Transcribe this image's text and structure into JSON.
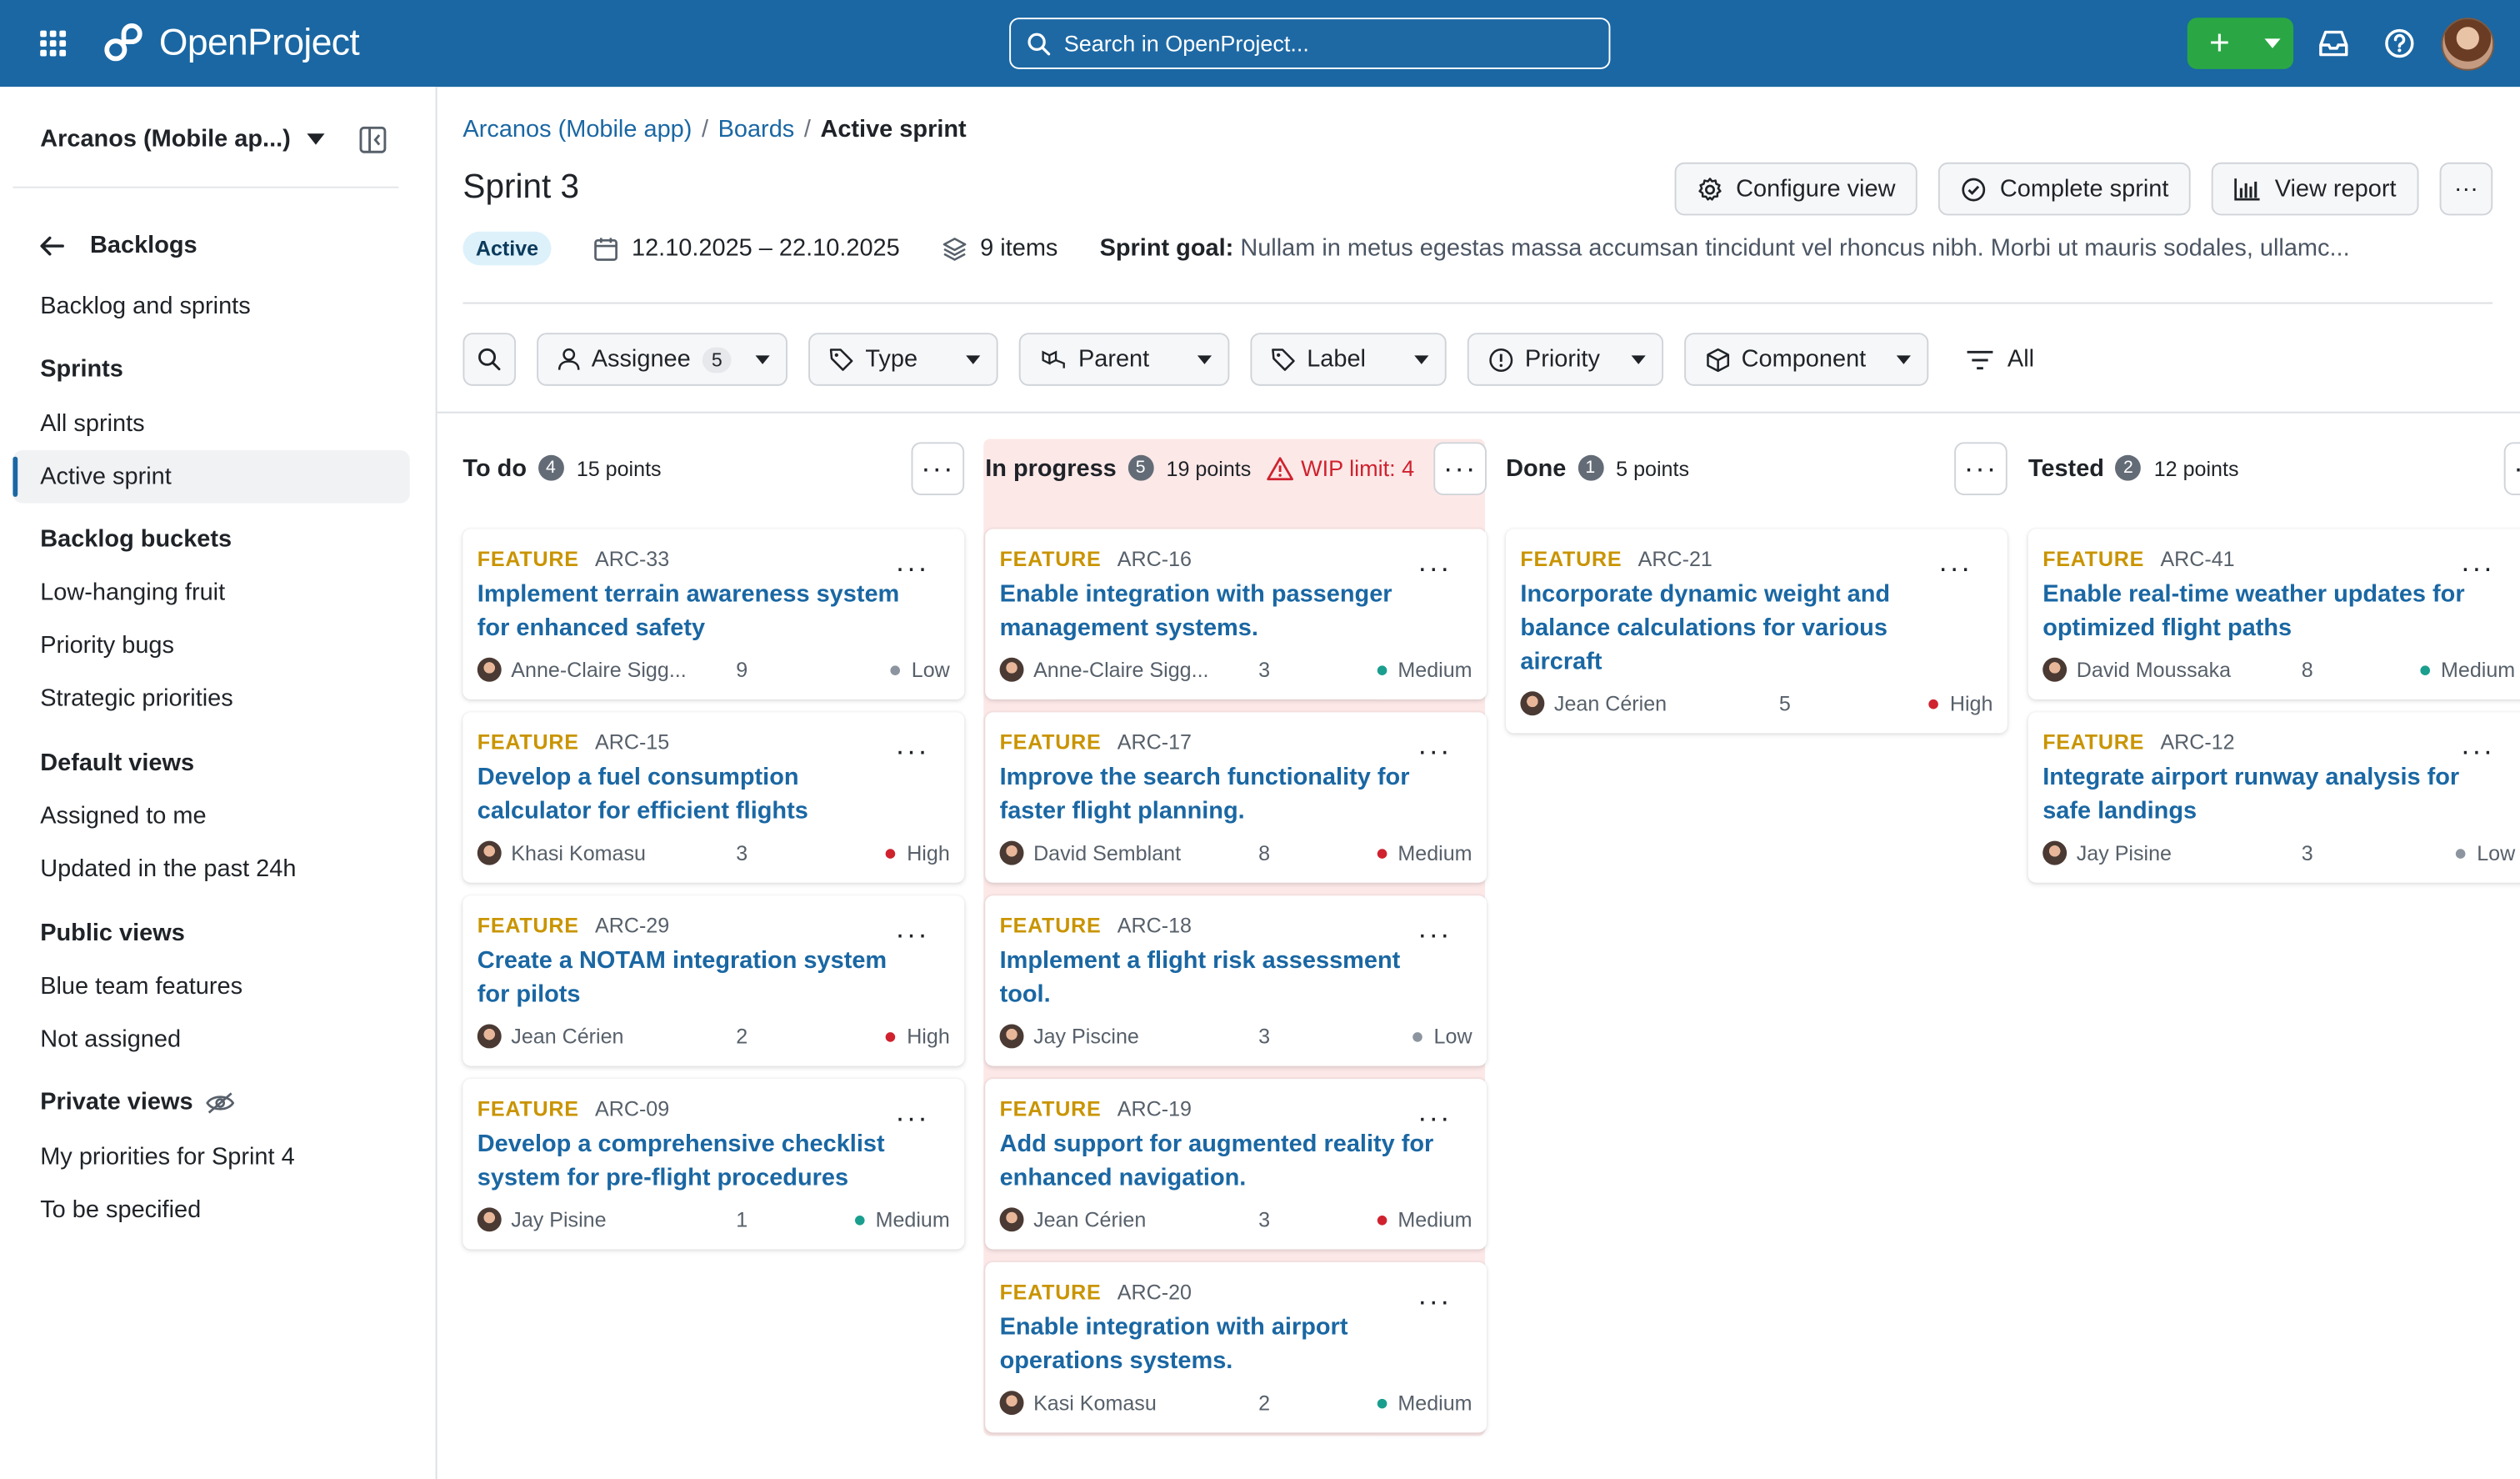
{
  "header": {
    "logo_text": "OpenProject",
    "search_placeholder": "Search in OpenProject...",
    "brand_color": "#1a67a3",
    "create_color": "#2aa744"
  },
  "sidebar": {
    "project": "Arcanos (Mobile ap...)",
    "back_label": "Backlogs",
    "items": {
      "backlog_and_sprints": "Backlog and sprints",
      "sprints_heading": "Sprints",
      "all_sprints": "All sprints",
      "active_sprint": "Active sprint",
      "buckets_heading": "Backlog buckets",
      "low_hanging": "Low-hanging fruit",
      "priority_bugs": "Priority bugs",
      "strategic": "Strategic priorities",
      "default_heading": "Default views",
      "assigned_to_me": "Assigned to me",
      "updated_24h": "Updated in the past 24h",
      "public_heading": "Public views",
      "blue_team": "Blue team features",
      "not_assigned": "Not assigned",
      "private_heading": "Private views",
      "my_priorities": "My priorities for Sprint 4",
      "to_be_specified": "To be specified"
    }
  },
  "breadcrumb": {
    "project": "Arcanos (Mobile app)",
    "boards": "Boards",
    "current": "Active sprint"
  },
  "page": {
    "title": "Sprint 3",
    "status": "Active",
    "dates": "12.10.2025 – 22.10.2025",
    "items": "9 items",
    "goal_label": "Sprint goal:",
    "goal_text": "Nullam in metus egestas massa accumsan tincidunt vel rhoncus nibh. Morbi ut mauris sodales, ullamc...",
    "buttons": {
      "configure": "Configure view",
      "complete": "Complete sprint",
      "report": "View report"
    }
  },
  "filters": {
    "assignee": "Assignee",
    "assignee_count": "5",
    "type": "Type",
    "parent": "Parent",
    "label": "Label",
    "priority": "Priority",
    "component": "Component",
    "all": "All"
  },
  "columns": [
    {
      "title": "To do",
      "count": "4",
      "points": "15 points",
      "wip": "",
      "cards": [
        {
          "type": "FEATURE",
          "id": "ARC-33",
          "title": "Implement terrain awareness system for enhanced safety",
          "assignee": "Anne-Claire Sigg...",
          "points": "9",
          "priority": "Low",
          "priority_color": "#8c959f"
        },
        {
          "type": "FEATURE",
          "id": "ARC-15",
          "title": "Develop a fuel consumption calculator for efficient flights",
          "assignee": "Khasi Komasu",
          "points": "3",
          "priority": "High",
          "priority_color": "#cf222e"
        },
        {
          "type": "FEATURE",
          "id": "ARC-29",
          "title": "Create a NOTAM integration system for pilots",
          "assignee": "Jean Cérien",
          "points": "2",
          "priority": "High",
          "priority_color": "#cf222e"
        },
        {
          "type": "FEATURE",
          "id": "ARC-09",
          "title": "Develop a comprehensive checklist system for pre-flight procedures",
          "assignee": "Jay Pisine",
          "points": "1",
          "priority": "Medium",
          "priority_color": "#1a9e8e"
        }
      ]
    },
    {
      "title": "In progress",
      "count": "5",
      "points": "19 points",
      "wip": "WIP limit: 4",
      "cards": [
        {
          "type": "FEATURE",
          "id": "ARC-16",
          "title": "Enable integration with passenger management systems.",
          "assignee": "Anne-Claire Sigg...",
          "points": "3",
          "priority": "Medium",
          "priority_color": "#1a9e8e"
        },
        {
          "type": "FEATURE",
          "id": "ARC-17",
          "title": "Improve the search functionality for faster flight planning.",
          "assignee": "David Semblant",
          "points": "8",
          "priority": "Medium",
          "priority_color": "#cf222e"
        },
        {
          "type": "FEATURE",
          "id": "ARC-18",
          "title": "Implement a flight risk assessment tool.",
          "assignee": "Jay Piscine",
          "points": "3",
          "priority": "Low",
          "priority_color": "#8c959f"
        },
        {
          "type": "FEATURE",
          "id": "ARC-19",
          "title": "Add support for augmented reality for enhanced navigation.",
          "assignee": "Jean Cérien",
          "points": "3",
          "priority": "Medium",
          "priority_color": "#cf222e"
        },
        {
          "type": "FEATURE",
          "id": "ARC-20",
          "title": "Enable integration with airport operations systems.",
          "assignee": "Kasi Komasu",
          "points": "2",
          "priority": "Medium",
          "priority_color": "#1a9e8e"
        }
      ]
    },
    {
      "title": "Done",
      "count": "1",
      "points": "5 points",
      "wip": "",
      "cards": [
        {
          "type": "FEATURE",
          "id": "ARC-21",
          "title": "Incorporate dynamic weight and balance calculations for various aircraft",
          "assignee": "Jean Cérien",
          "points": "5",
          "priority": "High",
          "priority_color": "#cf222e"
        }
      ]
    },
    {
      "title": "Tested",
      "count": "2",
      "points": "12 points",
      "wip": "",
      "cards": [
        {
          "type": "FEATURE",
          "id": "ARC-41",
          "title": "Enable real-time weather updates for optimized flight paths",
          "assignee": "David Moussaka",
          "points": "8",
          "priority": "Medium",
          "priority_color": "#1a9e8e"
        },
        {
          "type": "FEATURE",
          "id": "ARC-12",
          "title": "Integrate airport runway analysis for safe landings",
          "assignee": "Jay Pisine",
          "points": "3",
          "priority": "Low",
          "priority_color": "#8c959f"
        }
      ]
    }
  ]
}
